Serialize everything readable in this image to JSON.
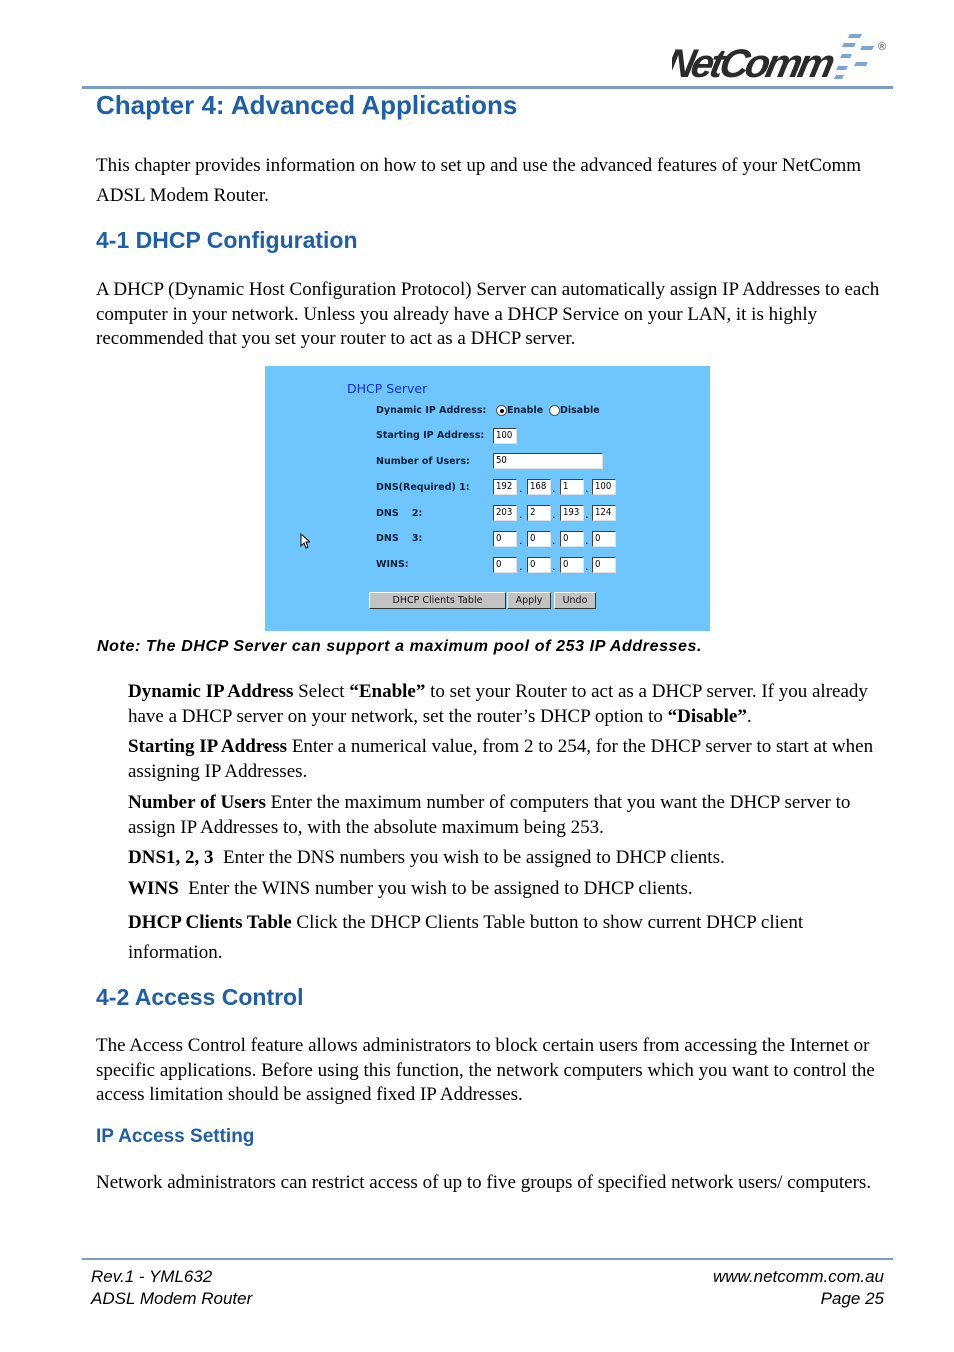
{
  "header": {
    "logo_text": "NetComm",
    "registered_mark": "®",
    "chapter_title": "Chapter 4: Advanced Applications"
  },
  "intro": "This chapter provides information on how to set up and use the advanced features of your NetComm ADSL Modem Router.",
  "section_dhcp": {
    "heading": "4-1 DHCP Configuration",
    "body": "A DHCP (Dynamic Host Configuration Protocol) Server can automatically assign IP Addresses to each computer in your network. Unless you already have a DHCP Service on your LAN, it is highly recommended that you set your router to act as a DHCP server."
  },
  "dhcp_screenshot": {
    "title": "DHCP Server",
    "dynamic_ip_label": "Dynamic IP Address:",
    "enable_label": "Enable",
    "disable_label": "Disable",
    "selected": "Enable",
    "starting_ip_label": "Starting IP Address:",
    "starting_ip_value": "100",
    "num_users_label": "Number of Users:",
    "num_users_value": "50",
    "dns1_label": "DNS(Required)   1:",
    "dns1": [
      "192",
      "168",
      "1",
      "100"
    ],
    "dns2_label": "DNS    2:",
    "dns2": [
      "203",
      "2",
      "193",
      "124"
    ],
    "dns3_label": "DNS    3:",
    "dns3": [
      "0",
      "0",
      "0",
      "0"
    ],
    "wins_label": "WINS:",
    "wins": [
      "0",
      "0",
      "0",
      "0"
    ],
    "buttons": {
      "clients_table": "DHCP Clients Table",
      "apply": "Apply",
      "undo": "Undo"
    }
  },
  "note": "Note:  The DHCP Server can support a maximum pool of 253 IP Addresses.",
  "definitions": [
    {
      "term": "Dynamic IP Address",
      "pre": " Select ",
      "b1": "“Enable”",
      "mid": " to set your Router to act as a DHCP server.   If you already have a DHCP server on your network, set the router’s DHCP option to ",
      "b2": "“Disable”",
      "post": "."
    },
    {
      "term": "Starting IP Address",
      "text": " Enter a numerical value, from 2 to 254, for the DHCP server to start at when assigning IP Addresses."
    },
    {
      "term": "Number of Users",
      "text": " Enter the maximum number of computers that you want the DHCP server to assign IP Addresses to, with the absolute maximum being 253."
    },
    {
      "term": "DNS1, 2, 3",
      "text": "  Enter the DNS numbers you wish to be assigned to DHCP clients."
    },
    {
      "term": "WINS",
      "text": "  Enter the WINS number you wish to be assigned to DHCP clients."
    },
    {
      "term": "DHCP Clients Table",
      "text": " Click the DHCP Clients Table button to show current DHCP client information."
    }
  ],
  "section_access": {
    "heading": "4-2 Access Control",
    "body": "The Access Control feature allows administrators to block certain users from accessing the Internet or specific applications. Before using this function, the network computers which you want to control the access limitation should be assigned fixed IP Addresses.",
    "sub_heading": "IP Access Setting",
    "sub_body": "Network administrators can restrict access of up to five groups of specified network users/ computers."
  },
  "footer": {
    "rev": "Rev.1 - YML632",
    "product": "ADSL Modem Router",
    "website": "www.netcomm.com.au",
    "page": "Page 25"
  },
  "colors": {
    "heading_blue": "#1f5fa8",
    "rule_blue": "#7a9cc6",
    "panel_bg": "#6ec6fc"
  }
}
